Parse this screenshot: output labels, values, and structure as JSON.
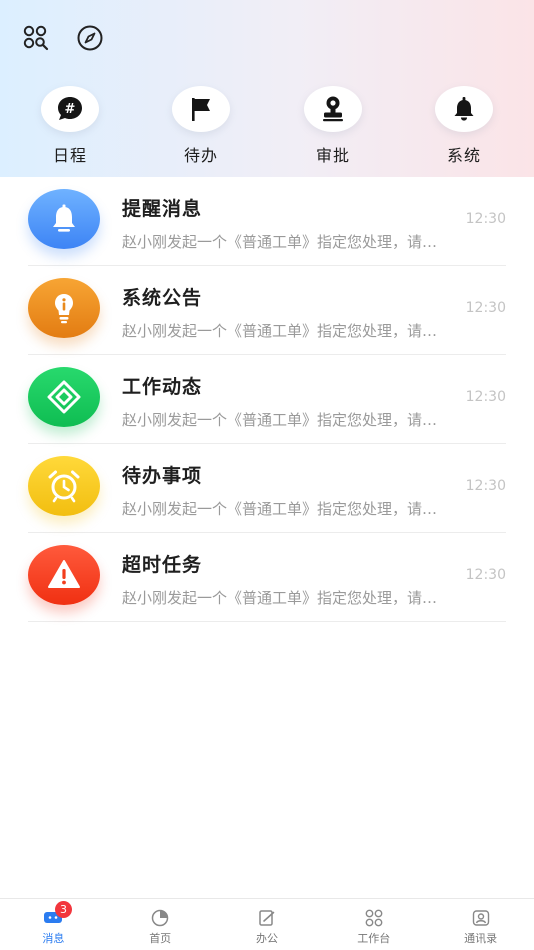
{
  "quick_actions": [
    {
      "label": "日程",
      "icon": "hashtag-bubble-icon"
    },
    {
      "label": "待办",
      "icon": "flag-icon"
    },
    {
      "label": "审批",
      "icon": "stamp-icon"
    },
    {
      "label": "系统",
      "icon": "bell-icon"
    }
  ],
  "messages": [
    {
      "title": "提醒消息",
      "desc": "赵小刚发起一个《普通工单》指定您处理，请及时处理",
      "time": "12:30",
      "icon": "bell-icon",
      "color": "#3d84f5"
    },
    {
      "title": "系统公告",
      "desc": "赵小刚发起一个《普通工单》指定您处理，请及时处理",
      "time": "12:30",
      "icon": "lightbulb-icon",
      "color": "#e37c12"
    },
    {
      "title": "工作动态",
      "desc": "赵小刚发起一个《普通工单》指定您处理，请及时处理",
      "time": "12:30",
      "icon": "diamond-icon",
      "color": "#0fbd52"
    },
    {
      "title": "待办事项",
      "desc": "赵小刚发起一个《普通工单》指定您处理，请及时处理",
      "time": "12:30",
      "icon": "alarm-clock-icon",
      "color": "#f2be10"
    },
    {
      "title": "超时任务",
      "desc": "赵小刚发起一个《普通工单》指定您处理，请及时处理",
      "time": "12:30",
      "icon": "warning-icon",
      "color": "#f03012"
    }
  ],
  "tabbar": {
    "active_color": "#2b7cf0",
    "badge": "3",
    "tabs": [
      {
        "label": "消息",
        "icon": "chat-icon",
        "active": true
      },
      {
        "label": "首页",
        "icon": "pie-chart-icon",
        "active": false
      },
      {
        "label": "办公",
        "icon": "edit-document-icon",
        "active": false
      },
      {
        "label": "工作台",
        "icon": "grid-icon",
        "active": false
      },
      {
        "label": "通讯录",
        "icon": "contacts-icon",
        "active": false
      }
    ]
  }
}
